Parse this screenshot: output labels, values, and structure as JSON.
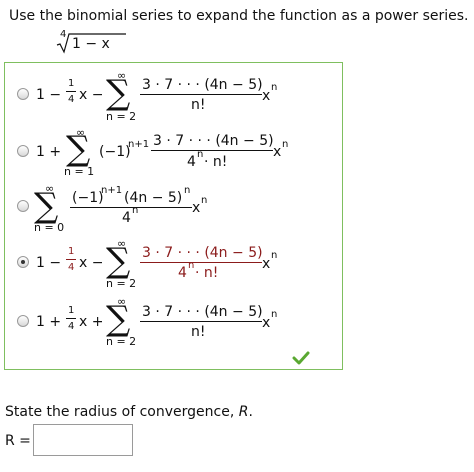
{
  "question": {
    "prompt": "Use the binomial series to expand the function as a power series.",
    "function": {
      "root_index": "4",
      "radicand": "1 − x"
    }
  },
  "options": [
    {
      "selected": false,
      "lead": "1 −",
      "coef_num": "1",
      "coef_den": "4",
      "after_coef": "x −",
      "sum_top": "∞",
      "sum_bottom": "n = 2",
      "frac_num": "3 · 7 · · · (4n − 5)",
      "frac_den": "n!",
      "tail_x": "x",
      "tail_exp": "n"
    },
    {
      "selected": false,
      "lead": "1 +",
      "sum_top": "∞",
      "sum_bottom": "n = 1",
      "pre_sign": "(−1)",
      "pre_sign_exp": "n+1",
      "frac_num": "3 · 7 · · · (4n − 5)",
      "frac_den_base": "4",
      "frac_den_exp": "n",
      "frac_den_rest": " · n!",
      "tail_x": "x",
      "tail_exp": "n"
    },
    {
      "selected": false,
      "sum_top": "∞",
      "sum_bottom": "n = 0",
      "num_a": "(−1)",
      "num_a_exp": "n+1",
      "num_b": "(4n − 5)",
      "num_b_exp": "n",
      "den_base": "4",
      "den_exp": "n",
      "tail_x": "x",
      "tail_exp": "n"
    },
    {
      "selected": true,
      "lead": "1 −",
      "coef_num": "1",
      "coef_den": "4",
      "after_coef": "x −",
      "sum_top": "∞",
      "sum_bottom": "n = 2",
      "frac_num": "3 · 7 · · · (4n − 5)",
      "frac_den_base": "4",
      "frac_den_exp": "n",
      "frac_den_rest": " · n!",
      "tail_x": "x",
      "tail_exp": "n"
    },
    {
      "selected": false,
      "lead": "1 +",
      "coef_num": "1",
      "coef_den": "4",
      "after_coef": "x +",
      "sum_top": "∞",
      "sum_bottom": "n = 2",
      "frac_num": "3 · 7 · · · (4n − 5)",
      "frac_den": "n!",
      "tail_x": "x",
      "tail_exp": "n"
    }
  ],
  "radius": {
    "prompt_text": "State the radius of convergence, ",
    "prompt_var": "R",
    "prompt_end": ".",
    "label": "R =",
    "value": ""
  },
  "colors": {
    "correct_check": "#5aa832",
    "box_border": "#7fbf5f",
    "selected_text": "#8b1b1b"
  },
  "icons": {
    "correct": "check-icon"
  }
}
